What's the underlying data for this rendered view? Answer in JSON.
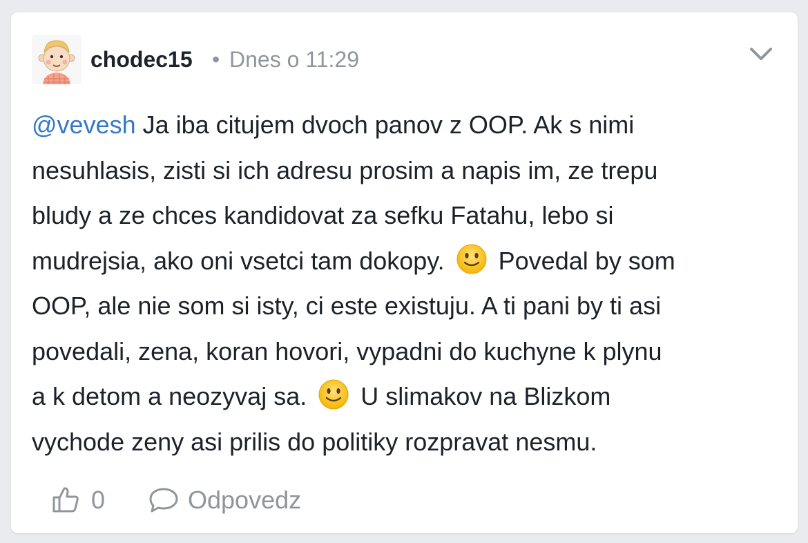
{
  "comment": {
    "author": "chodec15",
    "separator": "•",
    "timestamp": "Dnes o 11:29",
    "mention": "@vevesh",
    "lines": [
      " Ja iba citujem dvoch panov z OOP. Ak s nimi",
      "nesuhlasis, zisti si ich adresu prosim a napis im, ze trepu",
      "bludy a ze chces kandidovat za sefku Fatahu, lebo si",
      "mudrejsia, ako oni vsetci tam dokopy.",
      "Povedal by som",
      "OOP, ale nie som si isty, ci este existuju. A ti pani by ti asi",
      "povedali, zena, koran hovori, vypadni do kuchyne k plynu",
      "a k detom a neozyvaj sa.",
      "U slimakov na Blizkom",
      "vychode zeny asi prilis do politiky rozpravat nesmu."
    ],
    "emoji": "slightly-smiling-face"
  },
  "actions": {
    "like_count": "0",
    "reply_label": "Odpovedz"
  },
  "colors": {
    "mention": "#3578c8",
    "muted": "#90949c",
    "text": "#1d2129",
    "background": "#e9ebee"
  }
}
